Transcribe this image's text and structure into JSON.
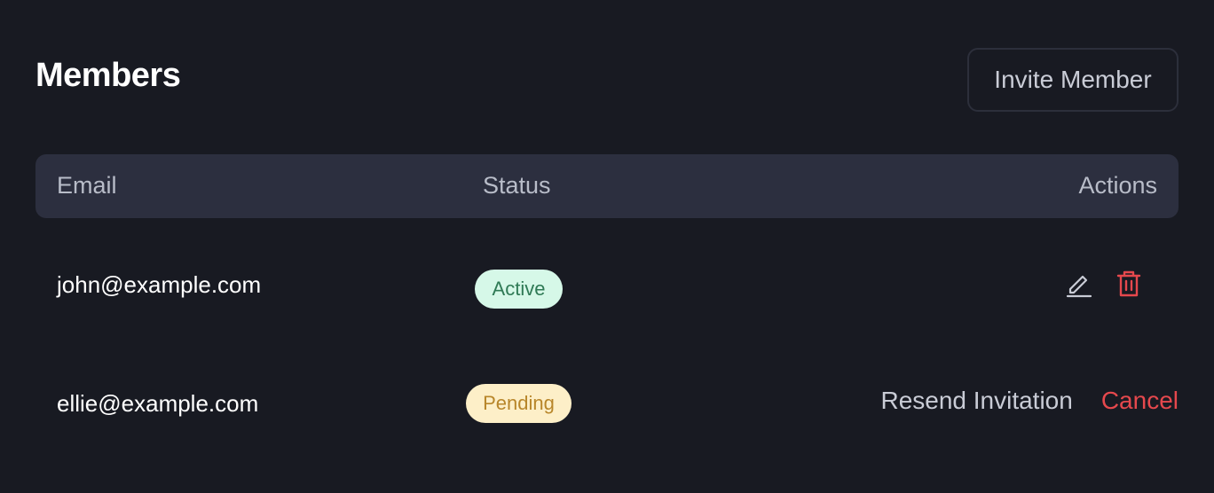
{
  "header": {
    "title": "Members",
    "invite_label": "Invite Member"
  },
  "table": {
    "columns": {
      "email": "Email",
      "status": "Status",
      "actions": "Actions"
    },
    "rows": [
      {
        "email": "john@example.com",
        "status": "Active",
        "actions": {
          "edit_icon": "pencil-icon",
          "delete_icon": "trash-icon"
        }
      },
      {
        "email": "ellie@example.com",
        "status": "Pending",
        "actions": {
          "resend_label": "Resend Invitation",
          "cancel_label": "Cancel"
        }
      }
    ]
  },
  "colors": {
    "background": "#181a22",
    "header_row": "#2c2f3f",
    "danger": "#e5484d",
    "active_badge_bg": "#d6f8e8",
    "active_badge_text": "#2f7a55",
    "pending_badge_bg": "#fdefc8",
    "pending_badge_text": "#b8862a"
  }
}
